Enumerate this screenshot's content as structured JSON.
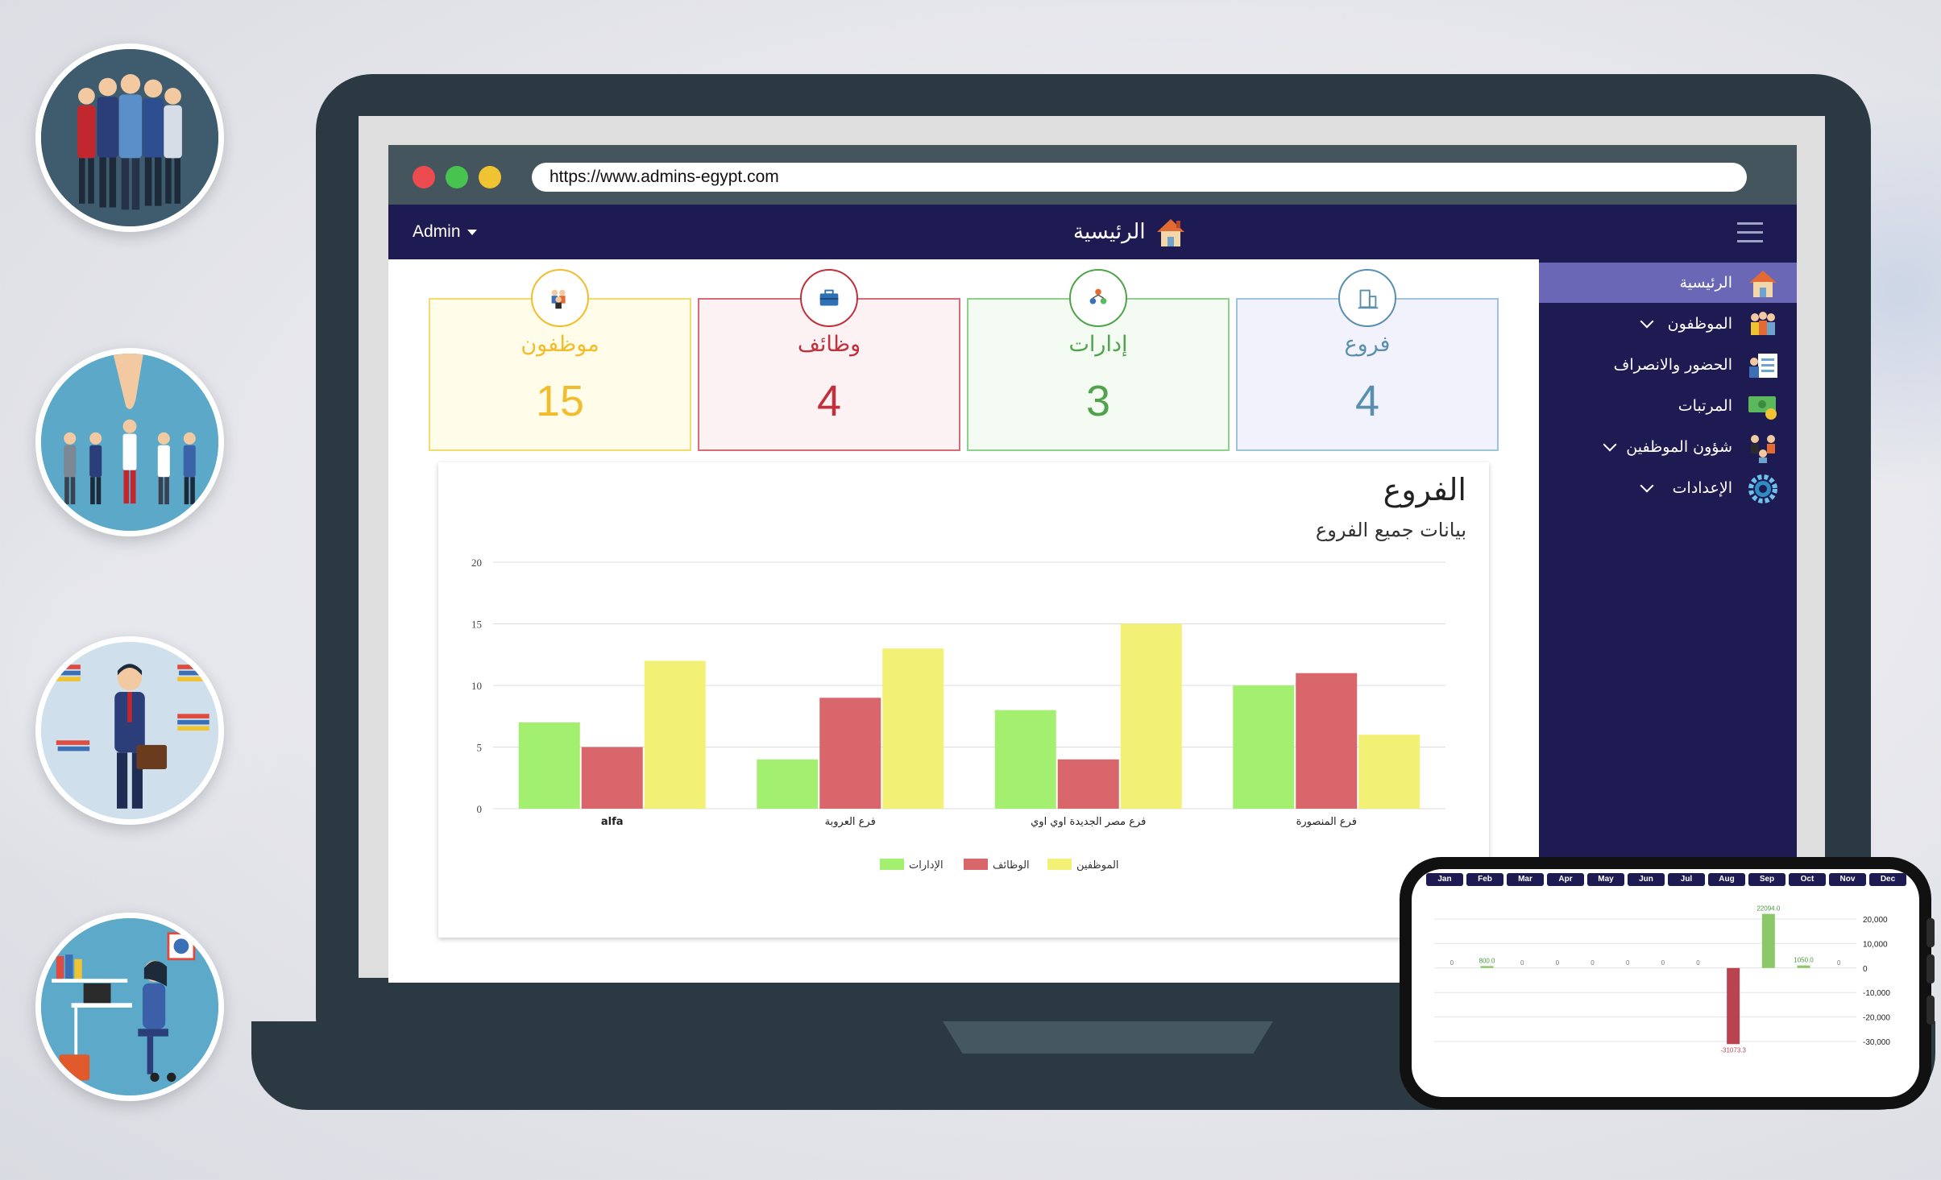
{
  "browser": {
    "url": "https://www.admins-egypt.com"
  },
  "topnav": {
    "user": "Admin",
    "title": "الرئيسية"
  },
  "sidebar": {
    "items": [
      {
        "label": "الرئيسية",
        "icon": "house-icon",
        "active": true,
        "has_submenu": false
      },
      {
        "label": "الموظفون",
        "icon": "employees-icon",
        "active": false,
        "has_submenu": true
      },
      {
        "label": "الحضور والانصراف",
        "icon": "attendance-icon",
        "active": false,
        "has_submenu": false
      },
      {
        "label": "المرتبات",
        "icon": "salaries-icon",
        "active": false,
        "has_submenu": false
      },
      {
        "label": "شؤون الموظفين",
        "icon": "hr-affairs-icon",
        "active": false,
        "has_submenu": true
      },
      {
        "label": "الإعدادات",
        "icon": "settings-gear-icon",
        "active": false,
        "has_submenu": true
      }
    ]
  },
  "stats": [
    {
      "label": "موظفون",
      "value": "15",
      "color": "#f2bd2c",
      "bg": "#fffde9",
      "icon": "employees-icon"
    },
    {
      "label": "وظائف",
      "value": "4",
      "color": "#c0303d",
      "bg": "#fdf2f3",
      "icon": "briefcase-icon"
    },
    {
      "label": "إدارات",
      "value": "3",
      "color": "#4fa34a",
      "bg": "#f4fbf2",
      "icon": "departments-icon"
    },
    {
      "label": "فروع",
      "value": "4",
      "color": "#5a8fae",
      "bg": "#f1f2fc",
      "icon": "building-icon"
    }
  ],
  "chart_card": {
    "title": "الفروع",
    "subtitle": "بيانات جميع الفروع"
  },
  "chart_data": [
    {
      "type": "bar",
      "categories": [
        "alfa",
        "فرع العروبة",
        "فرع مصر الجديدة اوي اوي",
        "فرع المنصورة"
      ],
      "series": [
        {
          "name": "الإدارات",
          "color": "#a3ef6f",
          "values": [
            7,
            4,
            8,
            10
          ]
        },
        {
          "name": "الوظائف",
          "color": "#d9666a",
          "values": [
            5,
            9,
            4,
            11
          ]
        },
        {
          "name": "الموظفين",
          "color": "#f2f075",
          "values": [
            12,
            13,
            15,
            6
          ]
        }
      ],
      "ylim": [
        0,
        20
      ],
      "yticks": [
        0,
        5,
        10,
        15,
        20
      ],
      "grid": true,
      "legend": "bottom"
    },
    {
      "type": "bar",
      "categories": [
        "Jan",
        "Feb",
        "Mar",
        "Apr",
        "May",
        "Jun",
        "Jul",
        "Aug",
        "Sep",
        "Oct",
        "Nov",
        "Dec"
      ],
      "values": [
        0,
        800,
        0,
        0,
        0,
        0,
        0,
        0,
        -31073.3,
        22094,
        1050,
        0
      ],
      "labels": [
        "0",
        "800.0",
        "0",
        "0",
        "0",
        "0",
        "0",
        "0",
        "-31073.3",
        "22094.0",
        "1050.0",
        "0"
      ],
      "ylim": [
        -30000,
        20000
      ],
      "yticks": [
        "20,000",
        "10,000",
        "0",
        "-10,000",
        "-20,000",
        "-30,000"
      ],
      "positive_color": "#8cc86a",
      "negative_color": "#b9434f",
      "grid": true
    }
  ]
}
